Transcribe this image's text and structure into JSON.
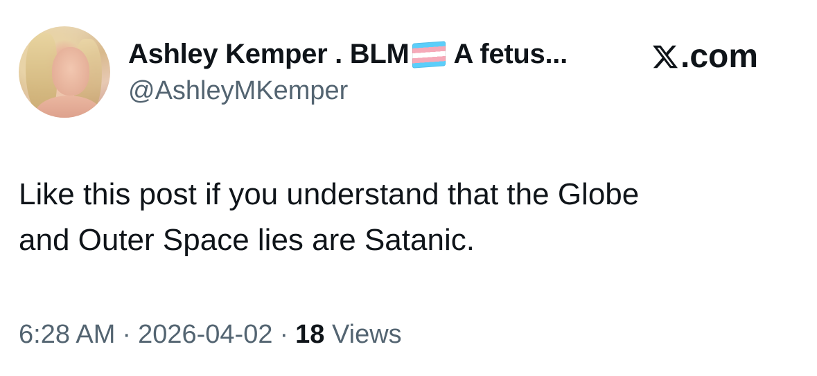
{
  "author": {
    "display_name_prefix": "Ashley Kemper . BLM",
    "flag_icon": "transgender-flag-icon",
    "display_name_suffix": "A fetus...",
    "handle": "@AshleyMKemper"
  },
  "brand": {
    "logo_icon": "x-logo-icon",
    "label": ".com"
  },
  "tweet": {
    "text_lines": [
      "Like this post if you understand that the Globe",
      "and Outer Space lies are Satanic."
    ]
  },
  "meta": {
    "time": "6:28 AM",
    "separator": "·",
    "date": "2026-04-02",
    "views_count": "18",
    "views_label": "Views"
  }
}
